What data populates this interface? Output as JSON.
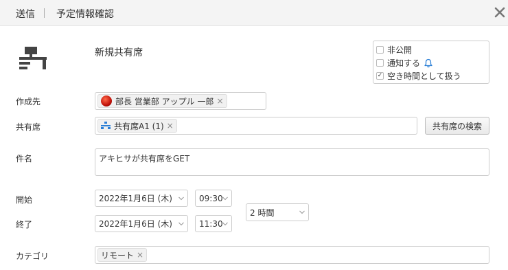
{
  "header": {
    "send_label": "送信",
    "title": "予定情報確認"
  },
  "main": {
    "new_title": "新規共有席"
  },
  "options": {
    "private_label": "非公開",
    "private_checked": false,
    "notify_label": "通知する",
    "notify_checked": false,
    "free_time_label": "空き時間として扱う",
    "free_time_checked": true
  },
  "form": {
    "creator_label": "作成先",
    "creator_chip": "部長 営業部 アップル 一郎",
    "seat_label": "共有席",
    "seat_chip": "共有席A1 (1)",
    "seat_search_button": "共有席の検索",
    "subject_label": "件名",
    "subject_value": "アキヒサが共有席をGET",
    "start_label": "開始",
    "start_date": "2022年1月6日 (木)",
    "start_time": "09:30",
    "end_label": "終了",
    "end_date": "2022年1月6日 (木)",
    "end_time": "11:30",
    "duration": "2 時間",
    "category_label": "カテゴリ",
    "category_chip": "リモート"
  },
  "icons": {
    "close": "close-icon",
    "desk": "desk-icon",
    "bell": "bell-icon",
    "avatar": "avatar",
    "seat": "seat-icon"
  },
  "colors": {
    "header_bg": "#f4f4f4",
    "bell": "#2b7fd6",
    "seat_icon": "#2b7fd6"
  }
}
